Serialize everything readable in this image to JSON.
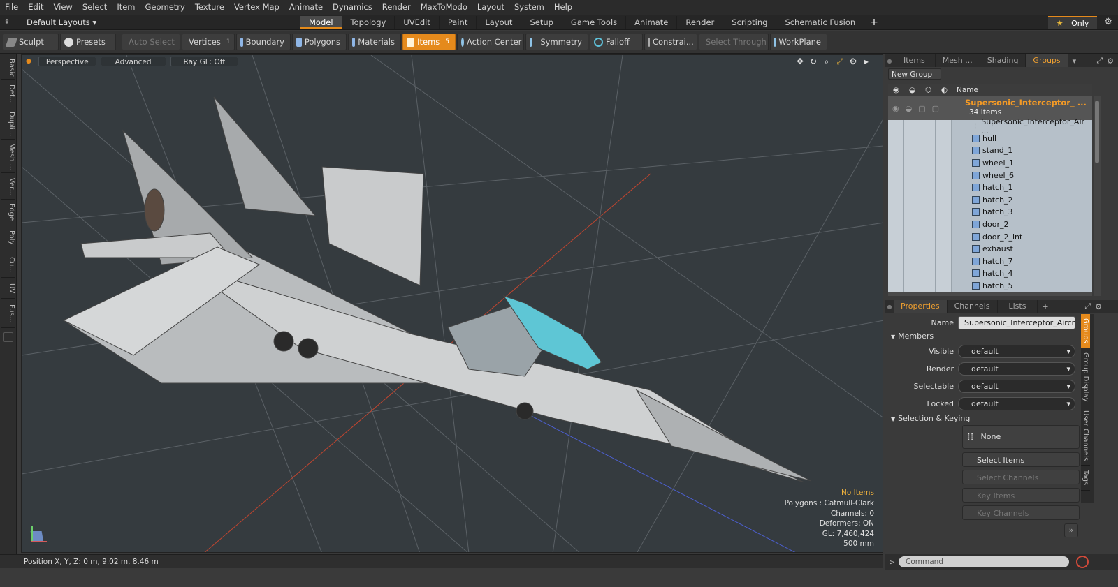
{
  "menu": [
    "File",
    "Edit",
    "View",
    "Select",
    "Item",
    "Geometry",
    "Texture",
    "Vertex Map",
    "Animate",
    "Dynamics",
    "Render",
    "MaxToModo",
    "Layout",
    "System",
    "Help"
  ],
  "layout": {
    "selector": "Default Layouts ▾",
    "tabs": [
      "Model",
      "Topology",
      "UVEdit",
      "Paint",
      "Layout",
      "Setup",
      "Game Tools",
      "Animate",
      "Render",
      "Scripting",
      "Schematic Fusion"
    ],
    "add": "+",
    "only": "Only"
  },
  "toolbar": {
    "sculpt": "Sculpt",
    "presets": "Presets",
    "auto_select": "Auto Select",
    "vertices": "Vertices",
    "vertices_count": "1",
    "boundary": "Boundary",
    "polygons": "Polygons",
    "materials": "Materials",
    "items": "Items",
    "items_count": "5",
    "action_center": "Action Center",
    "symmetry": "Symmetry",
    "falloff": "Falloff",
    "constraints": "Constrai...",
    "select_through": "Select Through",
    "workplane": "WorkPlane"
  },
  "left_tabs": [
    "Basic",
    "Def...",
    "Dupli...",
    "Mesh ...",
    "Ver...",
    "Edge",
    "Poly",
    "Cu...",
    "UV",
    "Fus..."
  ],
  "viewport": {
    "view": "Perspective",
    "shading": "Advanced",
    "raygl": "Ray GL: Off",
    "info": {
      "selection": "No Items",
      "polygons": "Polygons : Catmull-Clark",
      "channels": "Channels: 0",
      "deformers": "Deformers: ON",
      "gl": "GL: 7,460,424",
      "scale": "500 mm"
    }
  },
  "status": {
    "position": "Position X, Y, Z:   0 m, 9.02 m, 8.46 m"
  },
  "right_panel": {
    "top_tabs": [
      "Items",
      "Mesh ...",
      "Shading",
      "Groups"
    ],
    "new_group": "New Group",
    "name_col": "Name",
    "group_name": "Supersonic_Interceptor_ ...",
    "group_count": "34 Items",
    "items": [
      "Supersonic_Interceptor_Air ...",
      "hull",
      "stand_1",
      "wheel_1",
      "wheel_6",
      "hatch_1",
      "hatch_2",
      "hatch_3",
      "door_2",
      "door_2_int",
      "exhaust",
      "hatch_7",
      "hatch_4",
      "hatch_5"
    ],
    "bottom_tabs": [
      "Properties",
      "Channels",
      "Lists"
    ],
    "props": {
      "name_label": "Name",
      "name_value": "Supersonic_Interceptor_Aircraft",
      "members": "Members",
      "visible_label": "Visible",
      "visible_value": "default",
      "render_label": "Render",
      "render_value": "default",
      "selectable_label": "Selectable",
      "selectable_value": "default",
      "locked_label": "Locked",
      "locked_value": "default",
      "sel_keying": "Selection & Keying",
      "none": "None",
      "select_items": "Select Items",
      "select_channels": "Select Channels",
      "key_items": "Key Items",
      "key_channels": "Key Channels"
    },
    "side_tabs": [
      "Groups",
      "Group Display",
      "User Channels",
      "Tags"
    ]
  },
  "command": {
    "placeholder": "Command"
  }
}
